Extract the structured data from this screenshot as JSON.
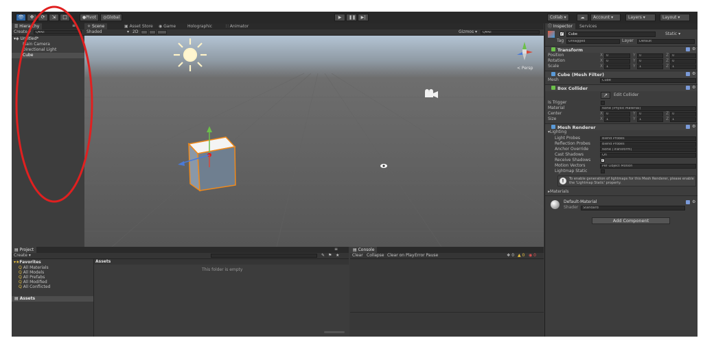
{
  "toolbar": {
    "tools": [
      "hand-tool-icon",
      "move-tool-icon",
      "rotate-tool-icon",
      "scale-tool-icon",
      "rect-tool-icon"
    ],
    "pivot_label": "Pivot",
    "global_label": "Global",
    "collab_label": "Collab ▾",
    "account_label": "Account",
    "layers_label": "Layers",
    "layout_label": "Layout"
  },
  "hierarchy": {
    "tab": "Hierarchy",
    "create": "Create ▾",
    "search_placeholder": "Q▾All",
    "scene_name": "Untitled*",
    "items": [
      "Main Camera",
      "Directional Light",
      "Cube"
    ]
  },
  "scene": {
    "tabs": [
      "Scene",
      "Asset Store",
      "Game",
      "Holographic",
      "Animator"
    ],
    "shading": "Shaded",
    "mode_2d": "2D",
    "gizmos": "Gizmos ▾",
    "search": "Q▾All",
    "persp": "< Persp"
  },
  "project": {
    "tab": "Project",
    "create": "Create ▾",
    "favorites": "Favorites",
    "fav_items": [
      "All Materials",
      "All Models",
      "All Prefabs",
      "All Modified",
      "All Conflicted"
    ],
    "assets_folder": "Assets",
    "assets_header": "Assets",
    "empty": "This folder is empty"
  },
  "console": {
    "tab": "Console",
    "buttons": [
      "Clear",
      "Collapse",
      "Clear on Play",
      "Error Pause"
    ]
  },
  "inspector": {
    "tabs": [
      "Inspector",
      "Services"
    ],
    "object_name": "Cube",
    "static": "Static ▾",
    "tag_label": "Tag",
    "tag_value": "Untagged",
    "layer_label": "Layer",
    "layer_value": "Default",
    "transform": {
      "title": "Transform",
      "rows": [
        {
          "label": "Position",
          "x": "0",
          "y": "0",
          "z": "0"
        },
        {
          "label": "Rotation",
          "x": "0",
          "y": "0",
          "z": "0"
        },
        {
          "label": "Scale",
          "x": "1",
          "y": "1",
          "z": "1"
        }
      ]
    },
    "mesh_filter": {
      "title": "Cube (Mesh Filter)",
      "mesh_label": "Mesh",
      "mesh_value": "Cube"
    },
    "box_collider": {
      "title": "Box Collider",
      "edit": "Edit Collider",
      "is_trigger": "Is Trigger",
      "material_label": "Material",
      "material_value": "None (Physic Material)",
      "center_label": "Center",
      "center": {
        "x": "0",
        "y": "0",
        "z": "0"
      },
      "size_label": "Size",
      "size": {
        "x": "1",
        "y": "1",
        "z": "1"
      }
    },
    "mesh_renderer": {
      "title": "Mesh Renderer",
      "lighting": "Lighting",
      "rows": [
        {
          "label": "Light Probes",
          "value": "Blend Probes"
        },
        {
          "label": "Reflection Probes",
          "value": "Blend Probes"
        },
        {
          "label": "Anchor Override",
          "value": "None (Transform)"
        },
        {
          "label": "Cast Shadows",
          "value": "On"
        },
        {
          "label": "Receive Shadows",
          "value": ""
        },
        {
          "label": "Motion Vectors",
          "value": "Per Object Motion"
        },
        {
          "label": "Lightmap Static",
          "value": ""
        }
      ],
      "info": "To enable generation of lightmaps for this Mesh Renderer, please enable the 'Lightmap Static' property."
    },
    "materials": "Materials",
    "default_material": "Default-Material",
    "shader_label": "Shader",
    "shader_value": "Standard",
    "add_component": "Add Component"
  },
  "colors": {
    "accent": "#2f67a6",
    "highlight": "#e02020",
    "selection_outline": "#f08a1c"
  }
}
